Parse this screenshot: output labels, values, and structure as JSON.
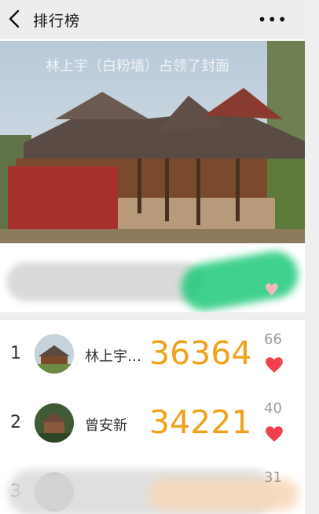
{
  "header": {
    "back_icon": "chevron-left-icon",
    "title": "排行榜",
    "more_icon": "more-dots-icon",
    "more_glyph": "•••"
  },
  "cover": {
    "caption": "林上宇（白粉墙）占领了封面",
    "image_subject": "covered bridge (langqiao) with upturned eaves"
  },
  "champion": {
    "heart_icon": "heart-icon"
  },
  "ranking": [
    {
      "rank": "1",
      "name": "林上宇…",
      "steps": "36364",
      "likes": "66",
      "liked": true
    },
    {
      "rank": "2",
      "name": "曾安新",
      "steps": "34221",
      "likes": "40",
      "liked": true
    },
    {
      "rank": "3",
      "name": "",
      "steps": "",
      "likes": "31",
      "liked": false
    }
  ],
  "colors": {
    "accent_steps": "#f2a11a",
    "heart": "#f0424d",
    "header_bg": "#ededed"
  }
}
